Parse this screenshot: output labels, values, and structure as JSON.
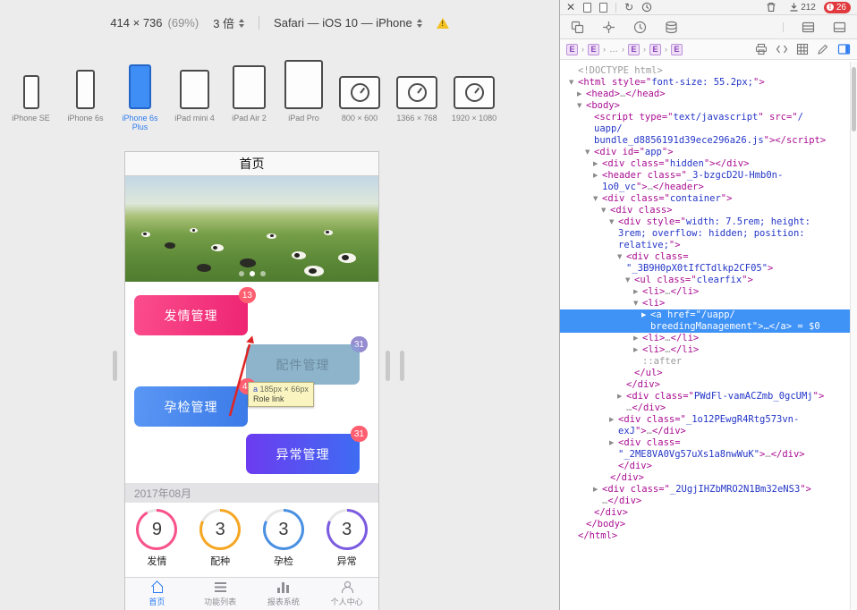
{
  "rwd_toolbar": {
    "dimensions": "414 × 736",
    "zoom": "(69%)",
    "scale_label": "3 倍",
    "ua_label": "Safari — iOS 10 — iPhone"
  },
  "device_strip": {
    "devices": [
      {
        "label": "iPhone SE",
        "selected": false
      },
      {
        "label": "iPhone 6s",
        "selected": false
      },
      {
        "label": "iPhone 6s Plus",
        "selected": true
      },
      {
        "label": "iPad mini 4",
        "selected": false
      },
      {
        "label": "iPad Air 2",
        "selected": false
      },
      {
        "label": "iPad Pro",
        "selected": false
      }
    ],
    "resolutions": [
      {
        "label": "800 × 600"
      },
      {
        "label": "1366 × 768"
      },
      {
        "label": "1920 × 1080"
      }
    ]
  },
  "app": {
    "header_title": "首页",
    "hero": {
      "dots": 3,
      "active_dot": 1
    },
    "buttons": [
      {
        "label": "发情管理",
        "badge": "13"
      },
      {
        "label": "配件管理",
        "badge": "31"
      },
      {
        "label": "孕检管理",
        "badge": "46"
      },
      {
        "label": "异常管理",
        "badge": "31"
      }
    ],
    "inspect_tooltip": {
      "element": "a",
      "size": "185px × 66px",
      "role_label": "Role",
      "role_value": "link"
    },
    "month_header": "2017年08月",
    "stats": [
      {
        "value": "9",
        "label": "发情",
        "color": "#f8528b",
        "pct": 92
      },
      {
        "value": "3",
        "label": "配种",
        "color": "#f5a623",
        "pct": 82
      },
      {
        "value": "3",
        "label": "孕检",
        "color": "#4a90e2",
        "pct": 82
      },
      {
        "value": "3",
        "label": "异常",
        "color": "#7b5be0",
        "pct": 82
      }
    ],
    "tabbar": [
      {
        "label": "首页",
        "active": true
      },
      {
        "label": "功能列表",
        "active": false
      },
      {
        "label": "报表系统",
        "active": false
      },
      {
        "label": "个人中心",
        "active": false
      }
    ]
  },
  "inspector": {
    "toolbar": {
      "resource_count": "212",
      "error_count": "26"
    },
    "breadcrumb": [
      "E",
      "E",
      "…",
      "E",
      "E",
      "E"
    ],
    "dom_lines": [
      {
        "i": 0,
        "a": "",
        "h": 0,
        "s": [
          [
            "g",
            "<!DOCTYPE html>"
          ]
        ]
      },
      {
        "i": 0,
        "a": "o",
        "h": 0,
        "s": [
          [
            "m",
            "<html "
          ],
          [
            "m",
            "style=\""
          ],
          [
            "b",
            "font-size: 55.2px;"
          ],
          [
            "m",
            "\">"
          ]
        ]
      },
      {
        "i": 1,
        "a": "c",
        "h": 0,
        "s": [
          [
            "m",
            "<head>"
          ],
          [
            "g",
            "…"
          ],
          [
            "m",
            "</head>"
          ]
        ]
      },
      {
        "i": 1,
        "a": "o",
        "h": 0,
        "s": [
          [
            "m",
            "<body>"
          ]
        ]
      },
      {
        "i": 2,
        "a": "",
        "h": 0,
        "s": [
          [
            "m",
            "<script "
          ],
          [
            "m",
            "type=\""
          ],
          [
            "b",
            "text/javascript"
          ],
          [
            "m",
            "\" "
          ],
          [
            "m",
            "src=\""
          ],
          [
            "b",
            "/"
          ]
        ]
      },
      {
        "i": 2,
        "a": "",
        "h": 0,
        "s": [
          [
            "b",
            "uapp/"
          ]
        ]
      },
      {
        "i": 2,
        "a": "",
        "h": 0,
        "s": [
          [
            "b",
            "bundle_d8856191d39ece296a26.js"
          ],
          [
            "m",
            "\"></script>"
          ]
        ]
      },
      {
        "i": 2,
        "a": "o",
        "h": 0,
        "s": [
          [
            "m",
            "<div "
          ],
          [
            "m",
            "id=\""
          ],
          [
            "b",
            "app"
          ],
          [
            "m",
            "\">"
          ]
        ]
      },
      {
        "i": 3,
        "a": "c",
        "h": 0,
        "s": [
          [
            "m",
            "<div "
          ],
          [
            "m",
            "class=\""
          ],
          [
            "b",
            "hidden"
          ],
          [
            "m",
            "\"></div>"
          ]
        ]
      },
      {
        "i": 3,
        "a": "c",
        "h": 0,
        "s": [
          [
            "m",
            "<header "
          ],
          [
            "m",
            "class=\""
          ],
          [
            "b",
            "_3-bzgcD2U-Hmb0n-"
          ]
        ]
      },
      {
        "i": 3,
        "a": "",
        "h": 0,
        "s": [
          [
            "b",
            "1o0_vc"
          ],
          [
            "m",
            "\">"
          ],
          [
            "g",
            "…"
          ],
          [
            "m",
            "</header>"
          ]
        ]
      },
      {
        "i": 3,
        "a": "o",
        "h": 0,
        "s": [
          [
            "m",
            "<div "
          ],
          [
            "m",
            "class=\""
          ],
          [
            "b",
            "container"
          ],
          [
            "m",
            "\">"
          ]
        ]
      },
      {
        "i": 4,
        "a": "o",
        "h": 0,
        "s": [
          [
            "m",
            "<div class>"
          ]
        ]
      },
      {
        "i": 5,
        "a": "o",
        "h": 0,
        "s": [
          [
            "m",
            "<div "
          ],
          [
            "m",
            "style=\""
          ],
          [
            "b",
            "width: 7.5rem; height:"
          ]
        ]
      },
      {
        "i": 5,
        "a": "",
        "h": 0,
        "s": [
          [
            "b",
            "3rem; overflow: hidden; position:"
          ]
        ]
      },
      {
        "i": 5,
        "a": "",
        "h": 0,
        "s": [
          [
            "b",
            "relative;"
          ],
          [
            "m",
            "\">"
          ]
        ]
      },
      {
        "i": 6,
        "a": "o",
        "h": 0,
        "s": [
          [
            "m",
            "<div "
          ],
          [
            "m",
            "class="
          ]
        ]
      },
      {
        "i": 6,
        "a": "",
        "h": 0,
        "s": [
          [
            "b",
            "\"_3B9H0pX0tIfCTdlkp2CF05\""
          ],
          [
            "m",
            ">"
          ]
        ]
      },
      {
        "i": 7,
        "a": "o",
        "h": 0,
        "s": [
          [
            "m",
            "<ul "
          ],
          [
            "m",
            "class=\""
          ],
          [
            "b",
            "clearfix"
          ],
          [
            "m",
            "\">"
          ]
        ]
      },
      {
        "i": 8,
        "a": "c",
        "h": 0,
        "s": [
          [
            "m",
            "<li>"
          ],
          [
            "g",
            "…"
          ],
          [
            "m",
            "</li>"
          ]
        ]
      },
      {
        "i": 8,
        "a": "o",
        "h": 0,
        "s": [
          [
            "m",
            "<li>"
          ]
        ]
      },
      {
        "i": 9,
        "a": "c",
        "h": 1,
        "s": [
          [
            "w",
            "<a "
          ],
          [
            "w",
            "href=\""
          ],
          [
            "w",
            "/uapp/"
          ]
        ]
      },
      {
        "i": 9,
        "a": "",
        "h": 1,
        "s": [
          [
            "w",
            "breedingManagement"
          ],
          [
            "w",
            "\">…</a>"
          ],
          [
            "w",
            " = $0"
          ]
        ]
      },
      {
        "i": 8,
        "a": "c",
        "h": 0,
        "s": [
          [
            "m",
            "<li>"
          ],
          [
            "g",
            "…"
          ],
          [
            "m",
            "</li>"
          ]
        ]
      },
      {
        "i": 8,
        "a": "c",
        "h": 0,
        "s": [
          [
            "m",
            "<li>"
          ],
          [
            "g",
            "…"
          ],
          [
            "m",
            "</li>"
          ]
        ]
      },
      {
        "i": 8,
        "a": "",
        "h": 0,
        "s": [
          [
            "g",
            "::after"
          ]
        ]
      },
      {
        "i": 7,
        "a": "",
        "h": 0,
        "s": [
          [
            "m",
            "</ul>"
          ]
        ]
      },
      {
        "i": 6,
        "a": "",
        "h": 0,
        "s": [
          [
            "m",
            "</div>"
          ]
        ]
      },
      {
        "i": 6,
        "a": "c",
        "h": 0,
        "s": [
          [
            "m",
            "<div "
          ],
          [
            "m",
            "class=\""
          ],
          [
            "b",
            "PWdFl-vamACZmb_0gcUMj"
          ],
          [
            "m",
            "\">"
          ]
        ]
      },
      {
        "i": 6,
        "a": "",
        "h": 0,
        "s": [
          [
            "g",
            "…"
          ],
          [
            "m",
            "</div>"
          ]
        ]
      },
      {
        "i": 5,
        "a": "c",
        "h": 0,
        "s": [
          [
            "m",
            "<div "
          ],
          [
            "m",
            "class=\""
          ],
          [
            "b",
            "_1o12PEwgR4Rtg573vn-"
          ]
        ]
      },
      {
        "i": 5,
        "a": "",
        "h": 0,
        "s": [
          [
            "b",
            "exJ"
          ],
          [
            "m",
            "\">"
          ],
          [
            "g",
            "…"
          ],
          [
            "m",
            "</div>"
          ]
        ]
      },
      {
        "i": 5,
        "a": "c",
        "h": 0,
        "s": [
          [
            "m",
            "<div "
          ],
          [
            "m",
            "class="
          ]
        ]
      },
      {
        "i": 5,
        "a": "",
        "h": 0,
        "s": [
          [
            "b",
            "\"_2ME8VA0Vg57uXs1a8nwWuK\""
          ],
          [
            "m",
            ">"
          ],
          [
            "g",
            "…"
          ],
          [
            "m",
            "</div>"
          ]
        ]
      },
      {
        "i": 5,
        "a": "",
        "h": 0,
        "s": [
          [
            "m",
            "</div>"
          ]
        ]
      },
      {
        "i": 4,
        "a": "",
        "h": 0,
        "s": [
          [
            "m",
            "</div>"
          ]
        ]
      },
      {
        "i": 3,
        "a": "c",
        "h": 0,
        "s": [
          [
            "m",
            "<div "
          ],
          [
            "m",
            "class=\""
          ],
          [
            "b",
            "_2UgjIHZbMRO2N1Bm32eNS3"
          ],
          [
            "m",
            "\">"
          ]
        ]
      },
      {
        "i": 3,
        "a": "",
        "h": 0,
        "s": [
          [
            "g",
            "…"
          ],
          [
            "m",
            "</div>"
          ]
        ]
      },
      {
        "i": 2,
        "a": "",
        "h": 0,
        "s": [
          [
            "m",
            "</div>"
          ]
        ]
      },
      {
        "i": 1,
        "a": "",
        "h": 0,
        "s": [
          [
            "m",
            "</body>"
          ]
        ]
      },
      {
        "i": 0,
        "a": "",
        "h": 0,
        "s": [
          [
            "m",
            "</html>"
          ]
        ]
      }
    ]
  }
}
